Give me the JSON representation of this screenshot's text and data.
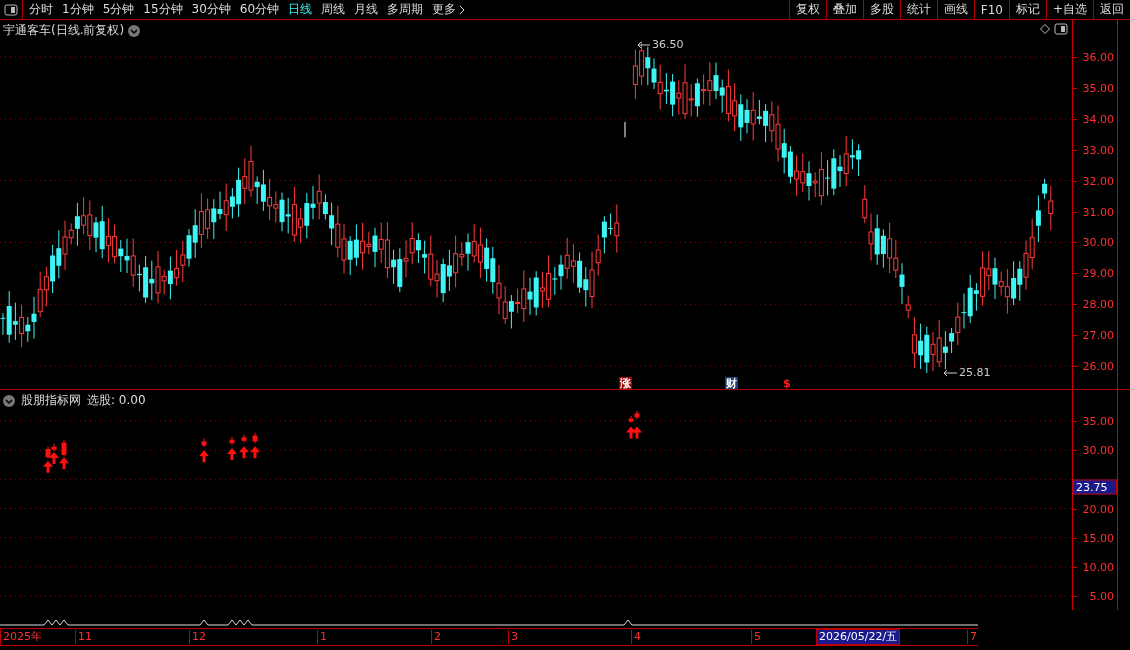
{
  "toolbar": {
    "periods": [
      {
        "label": "分时",
        "selected": false
      },
      {
        "label": "1分钟",
        "selected": false
      },
      {
        "label": "5分钟",
        "selected": false
      },
      {
        "label": "15分钟",
        "selected": false
      },
      {
        "label": "30分钟",
        "selected": false
      },
      {
        "label": "60分钟",
        "selected": false
      },
      {
        "label": "日线",
        "selected": true
      },
      {
        "label": "周线",
        "selected": false
      },
      {
        "label": "月线",
        "selected": false
      },
      {
        "label": "多周期",
        "selected": false
      },
      {
        "label": "更多",
        "selected": false
      }
    ],
    "buttons": [
      "复权",
      "叠加",
      "多股",
      "统计",
      "画线",
      "F10",
      "标记",
      "+自选",
      "返回"
    ]
  },
  "main_chart": {
    "title": "宇通客车(日线.前复权)",
    "y_labels": [
      "36.00",
      "35.00",
      "34.00",
      "33.00",
      "32.00",
      "31.00",
      "30.00",
      "29.00",
      "28.00",
      "27.00",
      "26.00"
    ],
    "high_label": "36.50",
    "low_label": "25.81",
    "event_marks": [
      {
        "label": "涨",
        "kind": "badge",
        "color": "#a00000"
      },
      {
        "label": "财",
        "kind": "badge",
        "color": "#1c3f7a"
      },
      {
        "label": "$",
        "kind": "glyph",
        "color": "#ff2020"
      }
    ]
  },
  "indicator_panel": {
    "title": "股朋指标网",
    "reading": "选股: 0.00",
    "y_labels": [
      "35.00",
      "30.00",
      "20.00",
      "15.00",
      "10.00",
      "5.00"
    ],
    "cursor_price": "23.75"
  },
  "time_axis": {
    "labels": [
      "2025年",
      "11",
      "12",
      "1",
      "2",
      "3",
      "4",
      "5",
      "7"
    ],
    "cursor_date": "2026/05/22/五"
  }
}
